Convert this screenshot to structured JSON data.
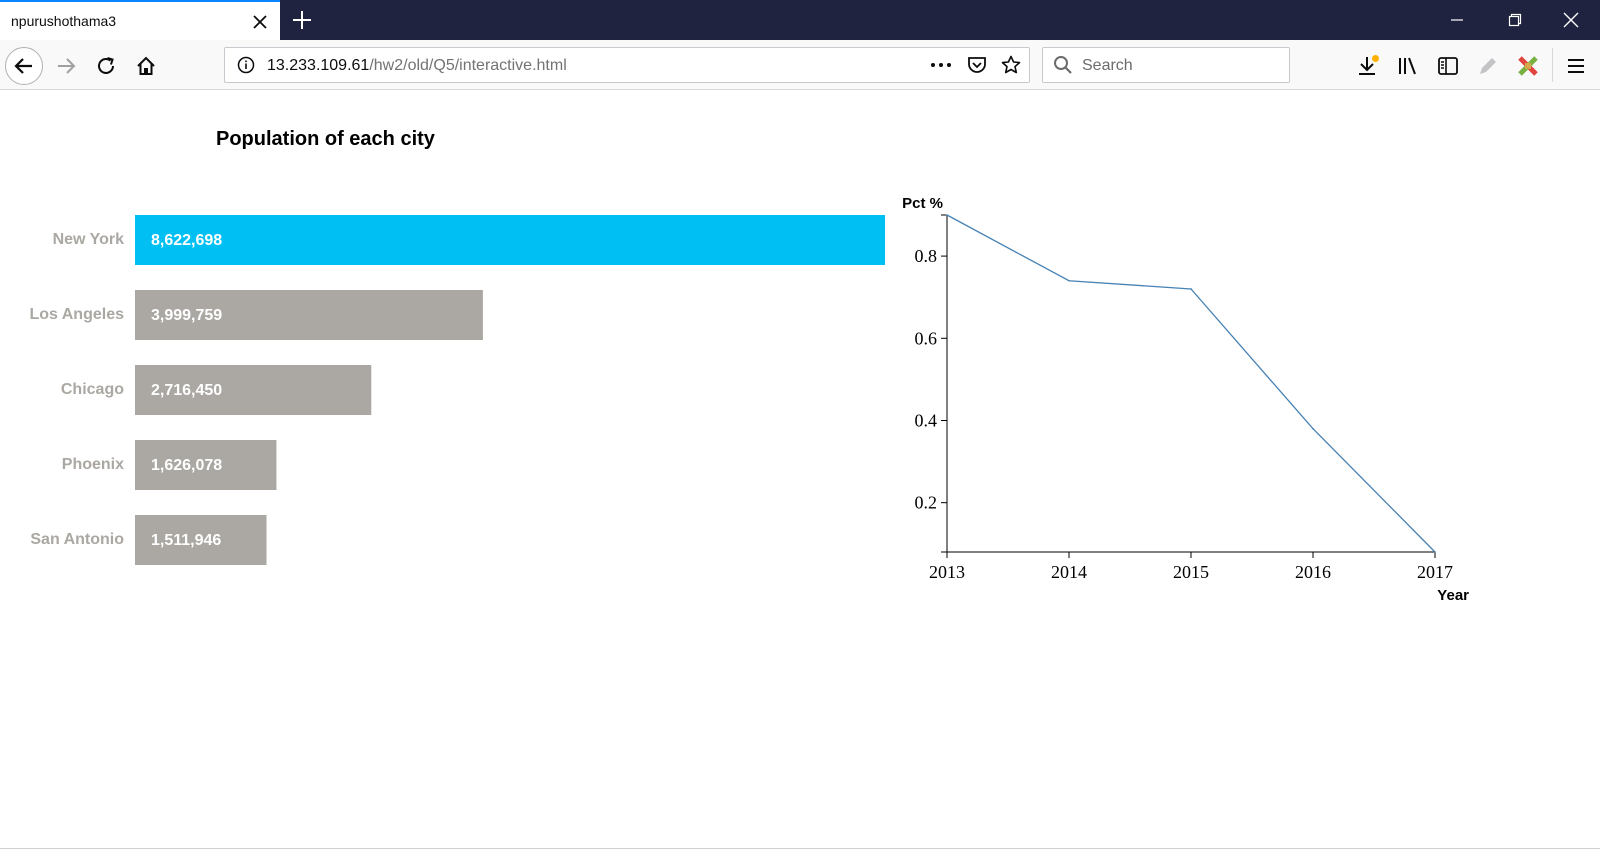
{
  "browser": {
    "tab_title": "npurushothama3",
    "url_host": "13.233.109.61",
    "url_path": "/hw2/old/Q5/interactive.html",
    "search_placeholder": "Search",
    "icons": [
      "close-icon",
      "plus-icon",
      "minimize-icon",
      "restore-icon",
      "window-close-icon",
      "back-arrow-icon",
      "forward-arrow-icon",
      "reload-icon",
      "home-icon",
      "info-icon",
      "more-icon",
      "pocket-icon",
      "star-icon",
      "search-icon",
      "download-icon",
      "library-icon",
      "sidebar-icon",
      "pencil-icon",
      "addon-icon",
      "menu-icon"
    ]
  },
  "chart_data": [
    {
      "type": "bar",
      "orientation": "horizontal",
      "title": "Population of each city",
      "categories": [
        "New York",
        "Los Angeles",
        "Chicago",
        "Phoenix",
        "San Antonio"
      ],
      "values": [
        8622698,
        3999759,
        2716450,
        1626078,
        1511946
      ],
      "value_labels": [
        "8,622,698",
        "3,999,759",
        "2,716,450",
        "1,626,078",
        "1,511,946"
      ],
      "highlighted": "New York",
      "colors": {
        "highlight": "#00bff3",
        "default": "#aba8a3",
        "category_label": "#aba8a3",
        "value_label": "#ffffff"
      }
    },
    {
      "type": "line",
      "xlabel": "Year",
      "ylabel": "Pct %",
      "x": [
        2013,
        2014,
        2015,
        2016,
        2017
      ],
      "y": [
        0.9,
        0.74,
        0.72,
        0.38,
        0.08
      ],
      "xlim": [
        2013,
        2017
      ],
      "ylim": [
        0.08,
        0.9
      ],
      "x_ticks": [
        "2013",
        "2014",
        "2015",
        "2016",
        "2017"
      ],
      "y_ticks": [
        "0.2",
        "0.4",
        "0.6",
        "0.8"
      ],
      "y_tick_values": [
        0.2,
        0.4,
        0.6,
        0.8
      ],
      "grid": false,
      "line_color": "#4682b4"
    }
  ]
}
